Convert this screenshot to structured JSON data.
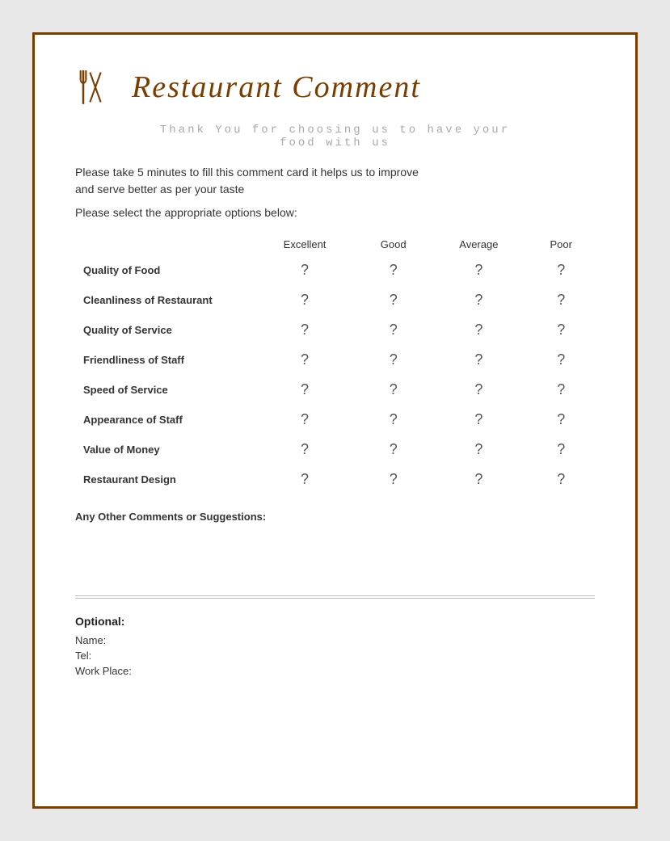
{
  "header": {
    "title": "Restaurant Comment"
  },
  "thank_you": {
    "line1": "Thank You for choosing us to have your",
    "line2": "food with us"
  },
  "intro": {
    "line1": "Please take 5 minutes to fill this comment card it helps us to improve",
    "line2": "and serve better as per your taste"
  },
  "select_prompt": "Please select the appropriate options below:",
  "columns": [
    "Excellent",
    "Good",
    "Average",
    "Poor"
  ],
  "rows": [
    {
      "label": "Quality of Food"
    },
    {
      "label": "Cleanliness of Restaurant"
    },
    {
      "label": "Quality of Service"
    },
    {
      "label": "Friendliness of Staff"
    },
    {
      "label": "Speed of Service"
    },
    {
      "label": "Appearance of Staff"
    },
    {
      "label": "Value of Money"
    },
    {
      "label": "Restaurant Design"
    }
  ],
  "comments_label": "Any Other Comments or Suggestions:",
  "optional": {
    "title": "Optional:",
    "fields": [
      {
        "label": "Name:"
      },
      {
        "label": "Tel:"
      },
      {
        "label": "Work Place:"
      }
    ]
  }
}
